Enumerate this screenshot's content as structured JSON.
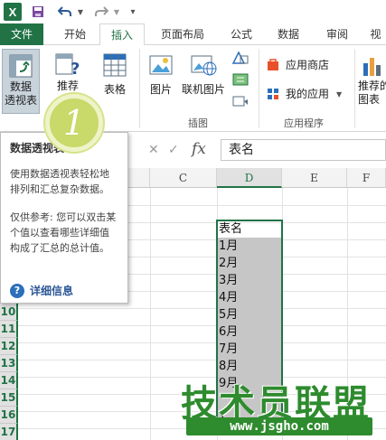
{
  "qat": {
    "logo": "X",
    "save_icon": "save-icon",
    "undo_icon": "undo-icon",
    "redo_icon": "redo-icon",
    "customize_icon": "customize-icon"
  },
  "tabs": [
    {
      "label": "文件"
    },
    {
      "label": "开始"
    },
    {
      "label": "插入"
    },
    {
      "label": "页面布局"
    },
    {
      "label": "公式"
    },
    {
      "label": "数据"
    },
    {
      "label": "审阅"
    },
    {
      "label": "视"
    }
  ],
  "ribbon": {
    "pivot_l1": "数据",
    "pivot_l2": "透视表",
    "rec_l1": "推荐",
    "rec_l2": "数",
    "table": "表格",
    "picture": "图片",
    "online_picture": "联机图片",
    "group_illustrations": "插图",
    "app_store": "应用商店",
    "my_apps": "我的应用",
    "group_apps": "应用程序",
    "rec_chart_l1": "推荐的",
    "rec_chart_l2": "图表"
  },
  "formula_bar": {
    "fx": "fx",
    "value": "表名"
  },
  "grid": {
    "columns": [
      "C",
      "D",
      "E",
      "F"
    ],
    "selected_column": "D",
    "rows": [
      "10",
      "11",
      "12",
      "13",
      "14",
      "15",
      "16",
      "17"
    ],
    "cells": [
      "表名",
      "1月",
      "2月",
      "3月",
      "4月",
      "5月",
      "6月",
      "7月",
      "8月",
      "9月",
      "",
      "1"
    ]
  },
  "tooltip": {
    "title": "数据透视表",
    "desc": "使用数据透视表轻松地排列和汇总复杂数据。",
    "note": "仅供参考: 您可以双击某个值以查看哪些详细值构成了汇总的总计值。",
    "more": "详细信息",
    "more_icon": "help-icon"
  },
  "step_marker": "1",
  "watermark": {
    "text": "技术员联盟",
    "url": "www.jsgho.com"
  },
  "colors": {
    "excel_green": "#217346",
    "marker": "#c9d96a",
    "watermark": "#2e8b2e"
  }
}
